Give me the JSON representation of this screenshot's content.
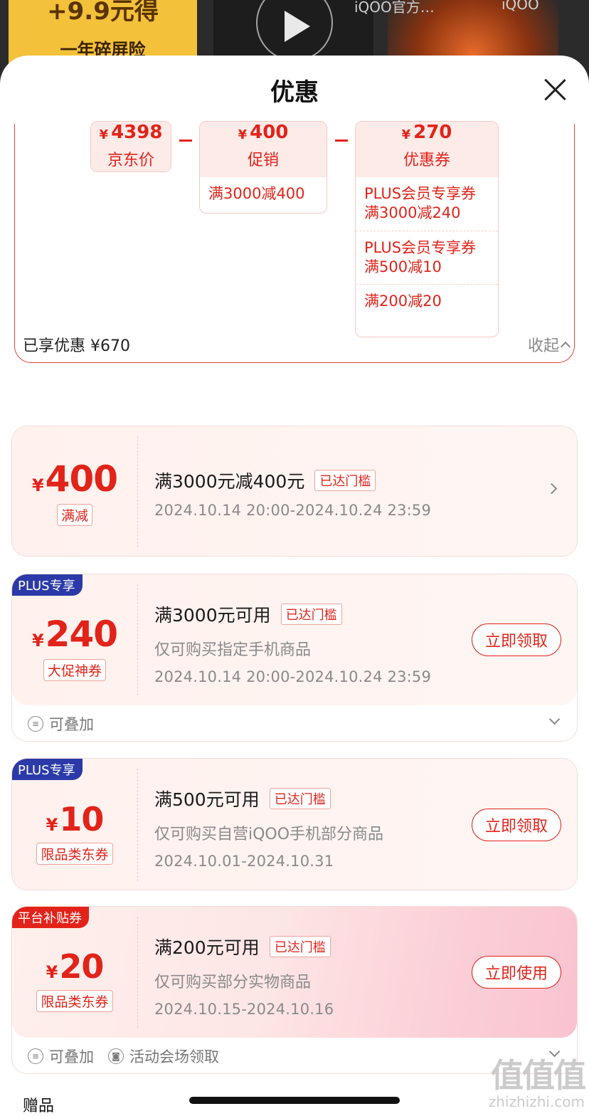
{
  "background": {
    "promo_line1": "+9.9元得",
    "promo_line2": "一年碎屏险",
    "tab1": "iQOO官方…",
    "tab2": "iQOO"
  },
  "sheet": {
    "title": "优惠"
  },
  "calc": {
    "jd_price": {
      "amount": "4398",
      "label": "京东价"
    },
    "promotion": {
      "amount": "400",
      "label": "促销",
      "items": [
        "满3000减400"
      ]
    },
    "coupon": {
      "amount": "270",
      "label": "优惠券",
      "items": [
        "PLUS会员专享券\n满3000减240",
        "PLUS会员专享券\n满500减10",
        "满200减20"
      ]
    },
    "currency": "¥"
  },
  "enjoyed": {
    "label": "已享优惠 ¥670",
    "collapse": "收起"
  },
  "coupons": [
    {
      "amount": "400",
      "tag": "满减",
      "condition": "满3000元减400元",
      "status": "已达门槛",
      "period": "2024.10.14 20:00-2024.10.24 23:59"
    },
    {
      "ribbon": "PLUS专享",
      "amount": "240",
      "tag": "大促神券",
      "condition": "满3000元可用",
      "status": "已达门槛",
      "desc": "仅可购买指定手机商品",
      "period": "2024.10.14 20:00-2024.10.24 23:59",
      "button": "立即领取",
      "foot": [
        "可叠加"
      ]
    },
    {
      "ribbon": "PLUS专享",
      "amount": "10",
      "tag": "限品类东券",
      "condition": "满500元可用",
      "status": "已达门槛",
      "desc": "仅可购买自营iQOO手机部分商品",
      "period": "2024.10.01-2024.10.31",
      "button": "立即领取"
    },
    {
      "ribbon": "平台补贴券",
      "amount": "20",
      "tag": "限品类东券",
      "condition": "满200元可用",
      "status": "已达门槛",
      "desc": "仅可购买部分实物商品",
      "period": "2024.10.15-2024.10.16",
      "button": "立即使用",
      "foot": [
        "可叠加",
        "活动会场领取"
      ]
    }
  ],
  "gifts": {
    "title": "赠品"
  },
  "watermark": {
    "big": "值值值",
    "site": "zhizhizhi.com"
  },
  "colors": {
    "accent": "#e2231a",
    "plus_blue": "#2b3aa8"
  }
}
